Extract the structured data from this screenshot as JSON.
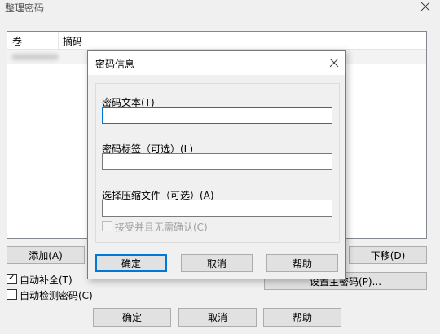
{
  "main_window": {
    "title": "整理密码",
    "table": {
      "columns": [
        "卷",
        "摘码"
      ]
    },
    "buttons": {
      "add": "添加(A)",
      "move_down": "下移(D)",
      "set_master": "设置主密码(P)...",
      "ok": "确定",
      "cancel": "取消",
      "help": "帮助"
    },
    "checkboxes": {
      "auto_complete": {
        "label": "自动补全(T)",
        "checked": true
      },
      "auto_detect": {
        "label": "自动检测密码(C)",
        "checked": false
      }
    }
  },
  "dialog": {
    "title": "密码信息",
    "fields": {
      "password_text": {
        "label": "密码文本(T)",
        "value": ""
      },
      "password_tag": {
        "label": "密码标签（可选）(L)",
        "value": ""
      },
      "archive_file": {
        "label": "选择压缩文件（可选）(A)",
        "value": ""
      }
    },
    "accept_checkbox": {
      "label": "接受并且无需确认(C)",
      "checked": false,
      "disabled": true
    },
    "buttons": {
      "ok": "确定",
      "cancel": "取消",
      "help": "帮助"
    }
  },
  "colors": {
    "accent": "#0078d7",
    "window_bg": "#f0f0f0",
    "button_bg": "#e1e1e1",
    "disabled_text": "#a0a0a0"
  }
}
